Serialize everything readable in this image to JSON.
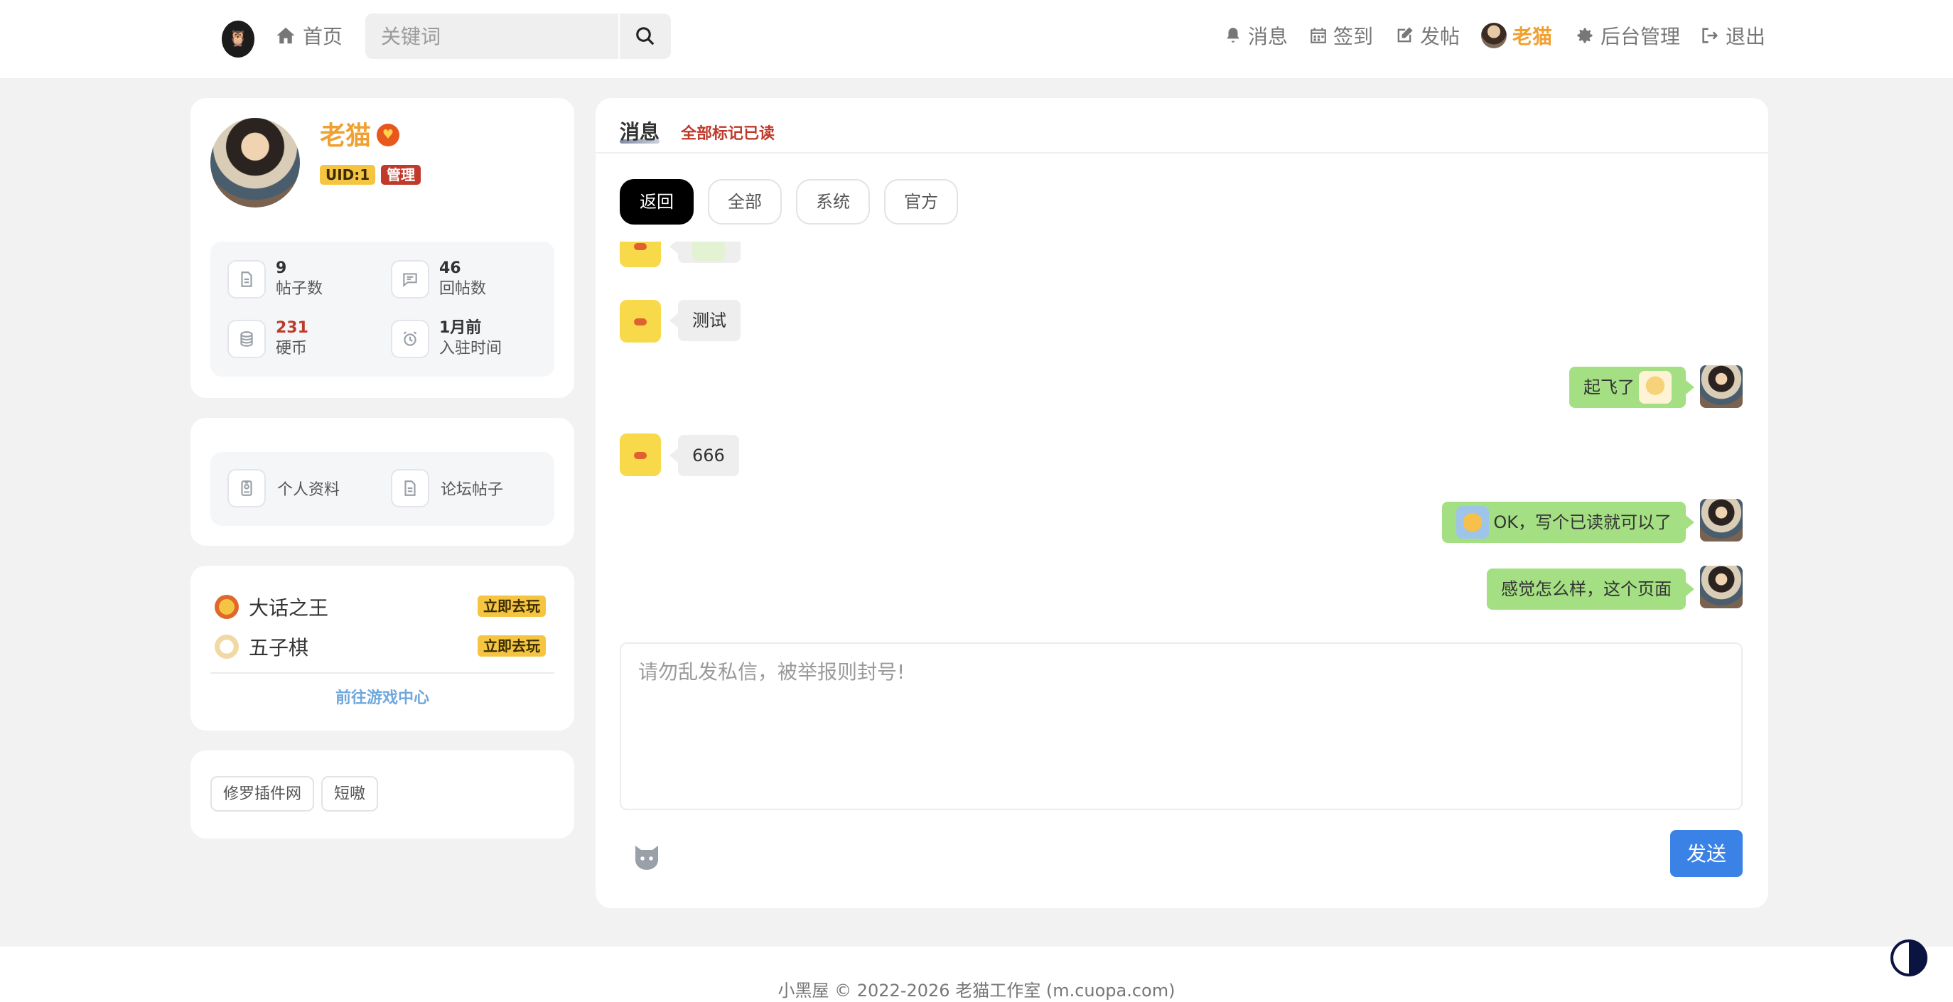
{
  "header": {
    "home_label": "首页",
    "search_placeholder": "关键词",
    "messages_label": "消息",
    "checkin_label": "签到",
    "post_label": "发帖",
    "user_label": "老猫",
    "admin_label": "后台管理",
    "logout_label": "退出"
  },
  "profile": {
    "name": "老猫",
    "uid_badge": "UID:1",
    "role_badge": "管理",
    "stats": {
      "posts_value": "9",
      "posts_label": "帖子数",
      "replies_value": "46",
      "replies_label": "回帖数",
      "coins_value": "231",
      "coins_label": "硬币",
      "joined_value": "1月前",
      "joined_label": "入驻时间"
    }
  },
  "quick_links": {
    "profile_label": "个人资料",
    "posts_label": "论坛帖子"
  },
  "games": {
    "items": [
      {
        "name": "大话之王",
        "button": "立即去玩"
      },
      {
        "name": "五子棋",
        "button": "立即去玩"
      }
    ],
    "center_link": "前往游戏中心"
  },
  "tags": [
    "修罗插件网",
    "短嗷"
  ],
  "messages_panel": {
    "title": "消息",
    "mark_all_read": "全部标记已读",
    "tabs": [
      "返回",
      "全部",
      "系统",
      "官方"
    ],
    "chat": [
      {
        "side": "left",
        "text": "测试"
      },
      {
        "side": "right",
        "text": "起飞了"
      },
      {
        "side": "left",
        "text": "666"
      },
      {
        "side": "right",
        "text": "OK，写个已读就可以了"
      },
      {
        "side": "right",
        "text": "感觉怎么样，这个页面"
      }
    ],
    "input_placeholder": "请勿乱发私信，被举报则封号!",
    "send_label": "发送"
  },
  "footer": {
    "text": "小黑屋 © 2022-2026 老猫工作室 (m.cuopa.com)"
  },
  "colors": {
    "accent_orange": "#f0a030",
    "send_blue": "#3b82e6",
    "bubble_green": "#a4e083",
    "badge_yellow": "#f5c542",
    "danger_red": "#c0392b"
  }
}
